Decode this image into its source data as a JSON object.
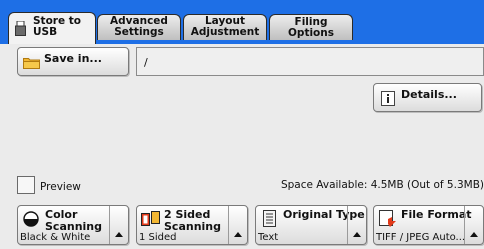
{
  "tabs": [
    {
      "label_line1": "Store to",
      "label_line2": "USB"
    },
    {
      "label_line1": "Advanced",
      "label_line2": "Settings"
    },
    {
      "label_line1": "Layout",
      "label_line2": "Adjustment"
    },
    {
      "label_line1": "Filing Options",
      "label_line2": ""
    }
  ],
  "save_in": {
    "label": "Save in...",
    "path": "/"
  },
  "details": {
    "label": "Details..."
  },
  "preview": {
    "label": "Preview"
  },
  "space": {
    "text": "Space Available: 4.5MB (Out of 5.3MB)"
  },
  "features": [
    {
      "label_line1": "Color",
      "label_line2": "Scanning",
      "value": "Black & White",
      "icon": "color-scanning-icon"
    },
    {
      "label_line1": "2 Sided",
      "label_line2": "Scanning",
      "value": "1 Sided",
      "icon": "two-sided-scanning-icon"
    },
    {
      "label_line1": "Original Type",
      "label_line2": "",
      "value": "Text",
      "icon": "document-icon"
    },
    {
      "label_line1": "File Format",
      "label_line2": "",
      "value": "TIFF / JPEG Auto...",
      "icon": "file-format-icon"
    }
  ],
  "colors": {
    "tabbar": "#1e6fe6",
    "folder": "#f2b632"
  }
}
